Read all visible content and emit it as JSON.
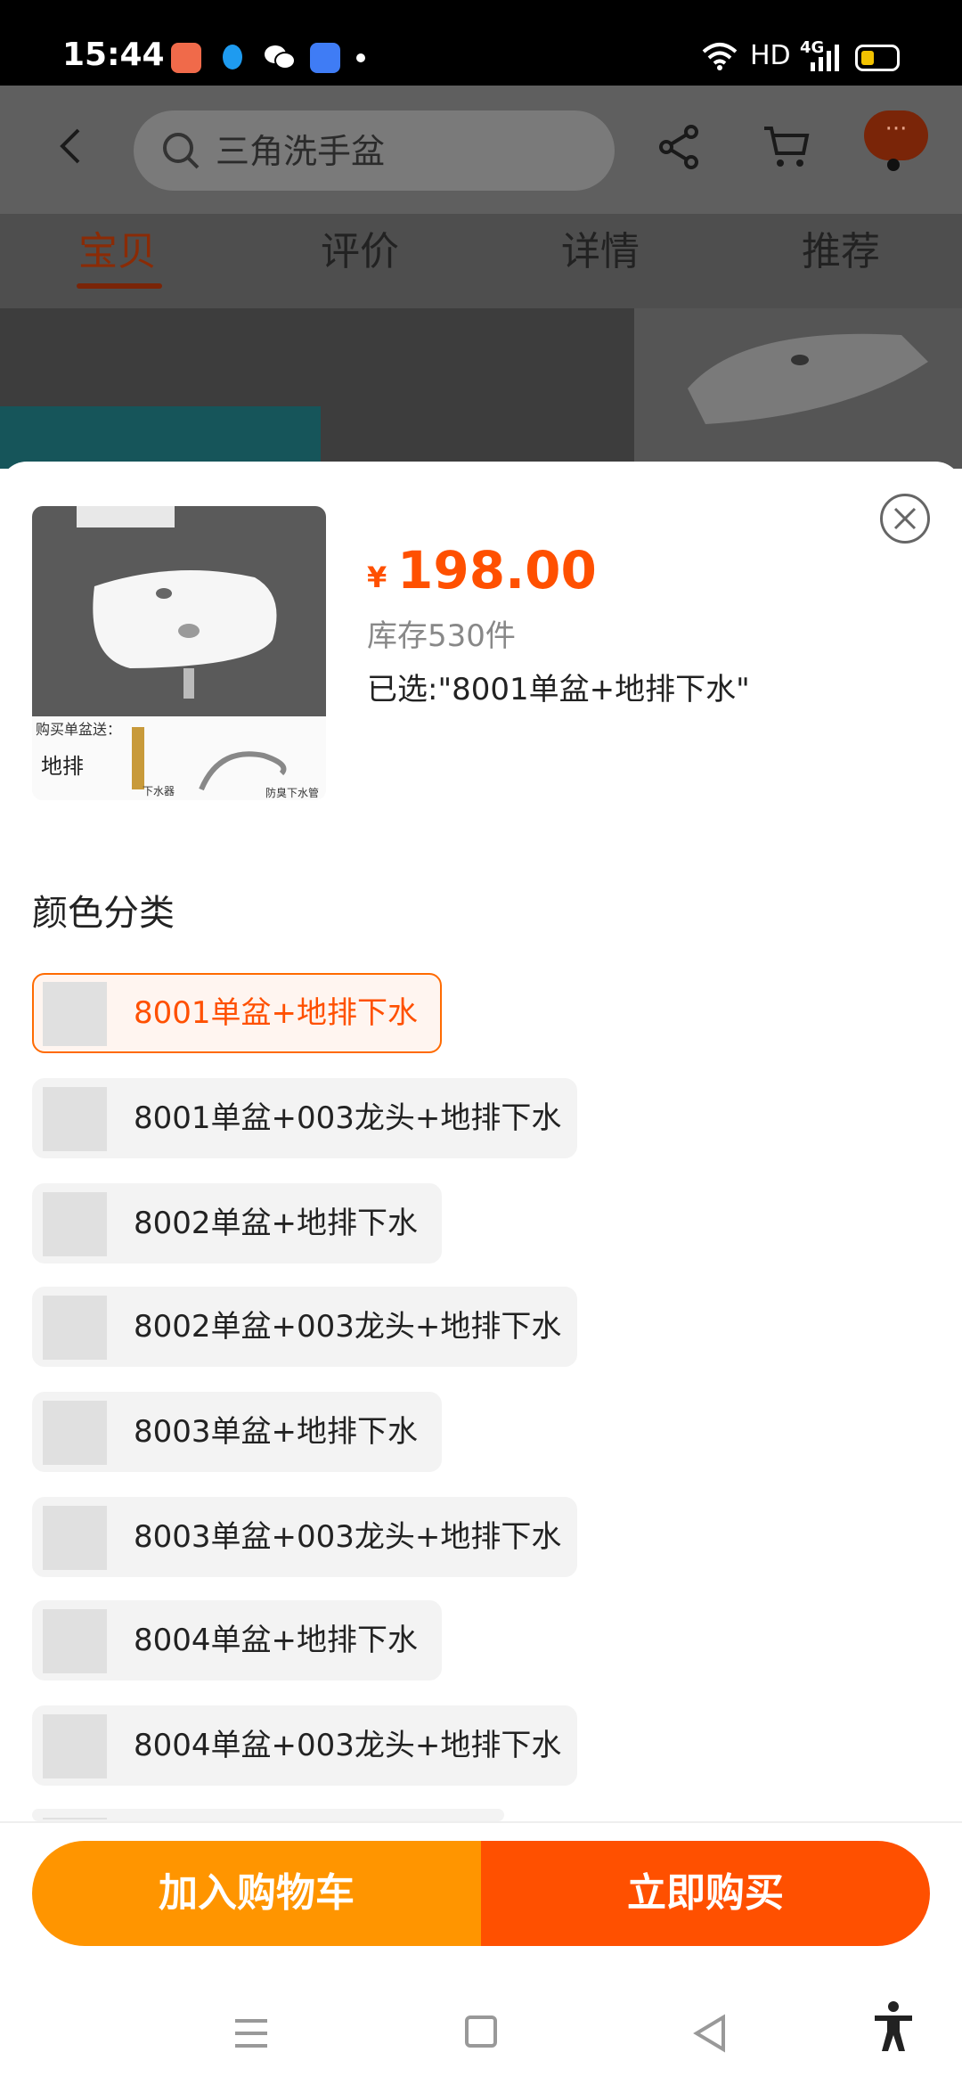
{
  "status_bar": {
    "time": "15:44",
    "network": "HD",
    "signal": "4G",
    "icons": [
      "app-notification-icon",
      "qq-icon",
      "wechat-icon",
      "app-icon",
      "wifi-icon",
      "signal-icon",
      "battery-icon"
    ]
  },
  "background_page": {
    "search_placeholder": "三角洗手盆",
    "more_label": "···",
    "tabs": [
      {
        "label": "宝贝",
        "active": true
      },
      {
        "label": "评价",
        "active": false
      },
      {
        "label": "详情",
        "active": false
      },
      {
        "label": "推荐",
        "active": false
      }
    ]
  },
  "product": {
    "price_symbol": "¥",
    "price": "198.00",
    "stock": "库存530件",
    "selected": "已选:\"8001单盆+地排下水\"",
    "thumb_promo": "购买单盆送：",
    "thumb_drain": "地排",
    "thumb_caption_1": "下水器",
    "thumb_caption_2": "防臭下水管"
  },
  "options_section": {
    "title": "颜色分类",
    "options": [
      {
        "label": "8001单盆+地排下水",
        "selected": true
      },
      {
        "label": "8001单盆+003龙头+地排下水",
        "selected": false
      },
      {
        "label": "8002单盆+地排下水",
        "selected": false
      },
      {
        "label": "8002单盆+003龙头+地排下水",
        "selected": false
      },
      {
        "label": "8003单盆+地排下水",
        "selected": false
      },
      {
        "label": "8003单盆+003龙头+地排下水",
        "selected": false
      },
      {
        "label": "8004单盆+地排下水",
        "selected": false
      },
      {
        "label": "8004单盆+003龙头+地排下水",
        "selected": false
      }
    ]
  },
  "actions": {
    "add_to_cart": "加入购物车",
    "buy_now": "立即购买"
  },
  "colors": {
    "accent": "#ff5000",
    "cart_button": "#ff9500",
    "selected_border": "#ff6a00"
  }
}
